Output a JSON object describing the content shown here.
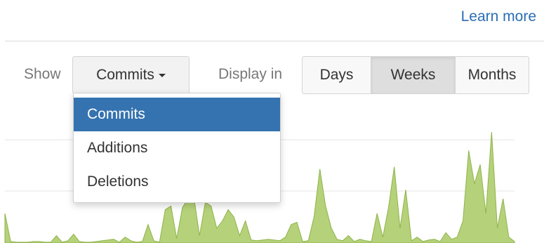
{
  "header": {
    "learn_more_label": "Learn more"
  },
  "controls": {
    "show_label": "Show",
    "metric_selected": "Commits",
    "display_label": "Display in",
    "period_buttons": [
      {
        "label": "Days",
        "active": false
      },
      {
        "label": "Weeks",
        "active": true
      },
      {
        "label": "Months",
        "active": false
      }
    ]
  },
  "dropdown": {
    "items": [
      {
        "label": "Commits",
        "selected": true
      },
      {
        "label": "Additions",
        "selected": false
      },
      {
        "label": "Deletions",
        "selected": false
      }
    ]
  },
  "colors": {
    "link": "#2a6db6",
    "menu_selected_bg": "#3572b0",
    "area_fill": "#b5d27a",
    "area_stroke": "#8fb34a"
  },
  "chart_data": {
    "type": "area",
    "x": [
      1,
      2,
      3,
      4,
      5,
      6,
      7,
      8,
      9,
      10,
      11,
      12,
      13,
      14,
      15,
      16,
      17,
      18,
      19,
      20,
      21,
      22,
      23,
      24,
      25,
      26,
      27,
      28,
      29,
      30,
      31,
      32,
      33,
      34,
      35,
      36,
      37,
      38,
      39,
      40,
      41,
      42,
      43,
      44,
      45,
      46,
      47,
      48,
      49,
      50,
      51,
      52,
      53,
      54,
      55,
      56,
      57,
      58,
      59,
      60,
      61,
      62,
      63,
      64,
      65,
      66,
      67,
      68,
      69,
      70,
      71,
      72,
      73,
      74,
      75,
      76,
      77,
      78,
      79,
      80,
      81,
      82,
      83,
      84,
      85,
      86,
      87,
      88,
      89,
      90
    ],
    "values": [
      40,
      2,
      1,
      1,
      1,
      2,
      2,
      1,
      1,
      10,
      1,
      3,
      12,
      2,
      1,
      1,
      2,
      3,
      4,
      5,
      1,
      8,
      3,
      1,
      2,
      25,
      3,
      1,
      45,
      50,
      6,
      48,
      60,
      62,
      10,
      55,
      50,
      20,
      30,
      45,
      35,
      10,
      30,
      4,
      3,
      4,
      5,
      4,
      3,
      8,
      25,
      28,
      2,
      3,
      36,
      100,
      50,
      20,
      5,
      3,
      10,
      2,
      5,
      3,
      2,
      40,
      8,
      48,
      103,
      20,
      72,
      3,
      8,
      2,
      4,
      5,
      2,
      14,
      5,
      8,
      30,
      125,
      80,
      106,
      40,
      150,
      20,
      60,
      8,
      2
    ],
    "grid": true
  }
}
